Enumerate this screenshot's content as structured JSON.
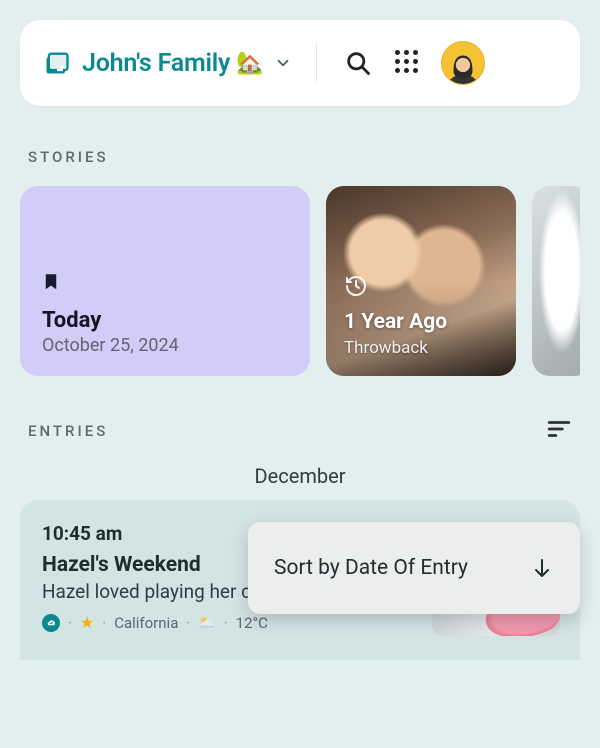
{
  "header": {
    "journal_name": "John's Family",
    "house_emoji": "🏡"
  },
  "sections": {
    "stories_label": "STORIES",
    "entries_label": "ENTRIES"
  },
  "stories": [
    {
      "title": "Today",
      "date": "October 25, 2024",
      "kind": "today"
    },
    {
      "title": "1 Year Ago",
      "subtitle": "Throwback",
      "kind": "throwback"
    },
    {
      "kind": "more"
    }
  ],
  "entries_date": "December",
  "sort_popover": {
    "label": "Sort by Date Of Entry"
  },
  "entry": {
    "time": "10:45 am",
    "title": "Hazel's Weekend",
    "excerpt": "Hazel loved playing her cousin's...",
    "location": "California",
    "temperature": "12°C"
  }
}
